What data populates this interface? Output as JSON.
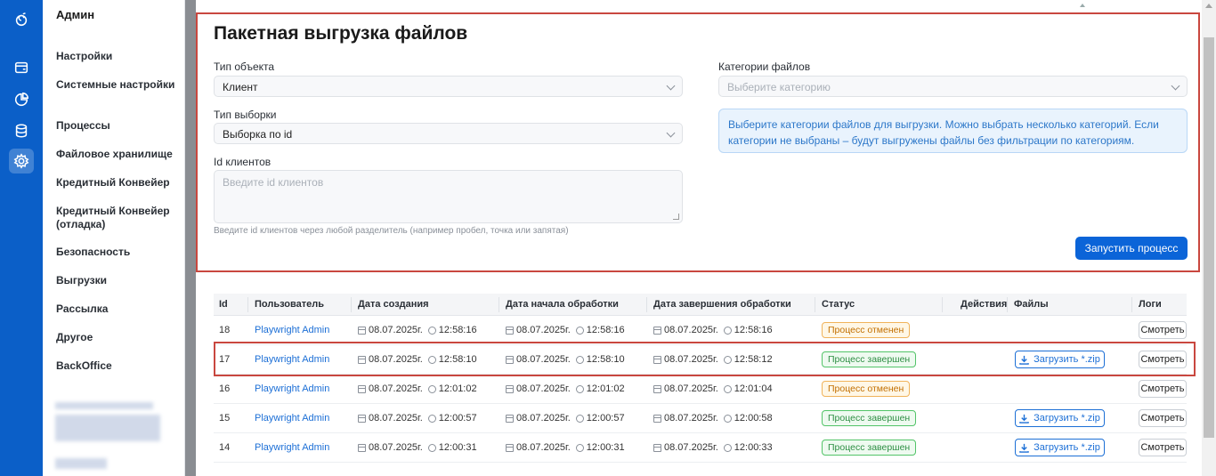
{
  "colors": {
    "rail": "#0b5fc8",
    "accent": "#0b64d8",
    "highlight": "#c9473f",
    "badge_cancel": "#f0b35a",
    "badge_done": "#52c468"
  },
  "rail_icons": [
    "logo-icon",
    "card-icon",
    "pie-chart-icon",
    "database-icon",
    "gear-icon"
  ],
  "sidebar": {
    "title": "Админ",
    "items": [
      {
        "label": "Настройки"
      },
      {
        "label": "Системные настройки"
      },
      {
        "label": "Процессы"
      },
      {
        "label": "Файловое хранилище"
      },
      {
        "label": "Кредитный Конвейер"
      },
      {
        "label": "Кредитный Конвейер (отладка)"
      },
      {
        "label": "Безопасность"
      },
      {
        "label": "Выгрузки"
      },
      {
        "label": "Рассылка"
      },
      {
        "label": "Другое"
      },
      {
        "label": "BackOffice"
      }
    ]
  },
  "form": {
    "title": "Пакетная выгрузка файлов",
    "object_type_label": "Тип объекта",
    "object_type_value": "Клиент",
    "selection_type_label": "Тип выборки",
    "selection_type_value": "Выборка по id",
    "client_ids_label": "Id клиентов",
    "client_ids_placeholder": "Введите id клиентов",
    "client_ids_hint": "Введите id клиентов через любой разделитель (например пробел, точка или запятая)",
    "categories_label": "Категории файлов",
    "categories_placeholder": "Выберите категорию",
    "info_text": "Выберите категории файлов для выгрузки. Можно выбрать несколько категорий. Если категории не выбраны – будут выгружены файлы без фильтрации по категориям.",
    "run_button": "Запустить процесс"
  },
  "table": {
    "headers": [
      "Id",
      "Пользователь",
      "Дата создания",
      "Дата начала обработки",
      "Дата завершения обработки",
      "Статус",
      "Действия",
      "Файлы",
      "Логи"
    ],
    "zip_label": "Загрузить *.zip",
    "logs_label": "Смотреть",
    "rows": [
      {
        "id": "18",
        "user": "Playwright Admin",
        "created_date": "08.07.2025г.",
        "created_time": "12:58:16",
        "start_date": "08.07.2025г.",
        "start_time": "12:58:16",
        "end_date": "08.07.2025г.",
        "end_time": "12:58:16",
        "status": "Процесс отменен",
        "status_kind": "cancel",
        "has_zip": false
      },
      {
        "id": "17",
        "user": "Playwright Admin",
        "created_date": "08.07.2025г.",
        "created_time": "12:58:10",
        "start_date": "08.07.2025г.",
        "start_time": "12:58:10",
        "end_date": "08.07.2025г.",
        "end_time": "12:58:12",
        "status": "Процесс завершен",
        "status_kind": "done",
        "has_zip": true
      },
      {
        "id": "16",
        "user": "Playwright Admin",
        "created_date": "08.07.2025г.",
        "created_time": "12:01:02",
        "start_date": "08.07.2025г.",
        "start_time": "12:01:02",
        "end_date": "08.07.2025г.",
        "end_time": "12:01:04",
        "status": "Процесс отменен",
        "status_kind": "cancel",
        "has_zip": false
      },
      {
        "id": "15",
        "user": "Playwright Admin",
        "created_date": "08.07.2025г.",
        "created_time": "12:00:57",
        "start_date": "08.07.2025г.",
        "start_time": "12:00:57",
        "end_date": "08.07.2025г.",
        "end_time": "12:00:58",
        "status": "Процесс завершен",
        "status_kind": "done",
        "has_zip": true
      },
      {
        "id": "14",
        "user": "Playwright Admin",
        "created_date": "08.07.2025г.",
        "created_time": "12:00:31",
        "start_date": "08.07.2025г.",
        "start_time": "12:00:31",
        "end_date": "08.07.2025г.",
        "end_time": "12:00:33",
        "status": "Процесс завершен",
        "status_kind": "done",
        "has_zip": true
      }
    ]
  }
}
